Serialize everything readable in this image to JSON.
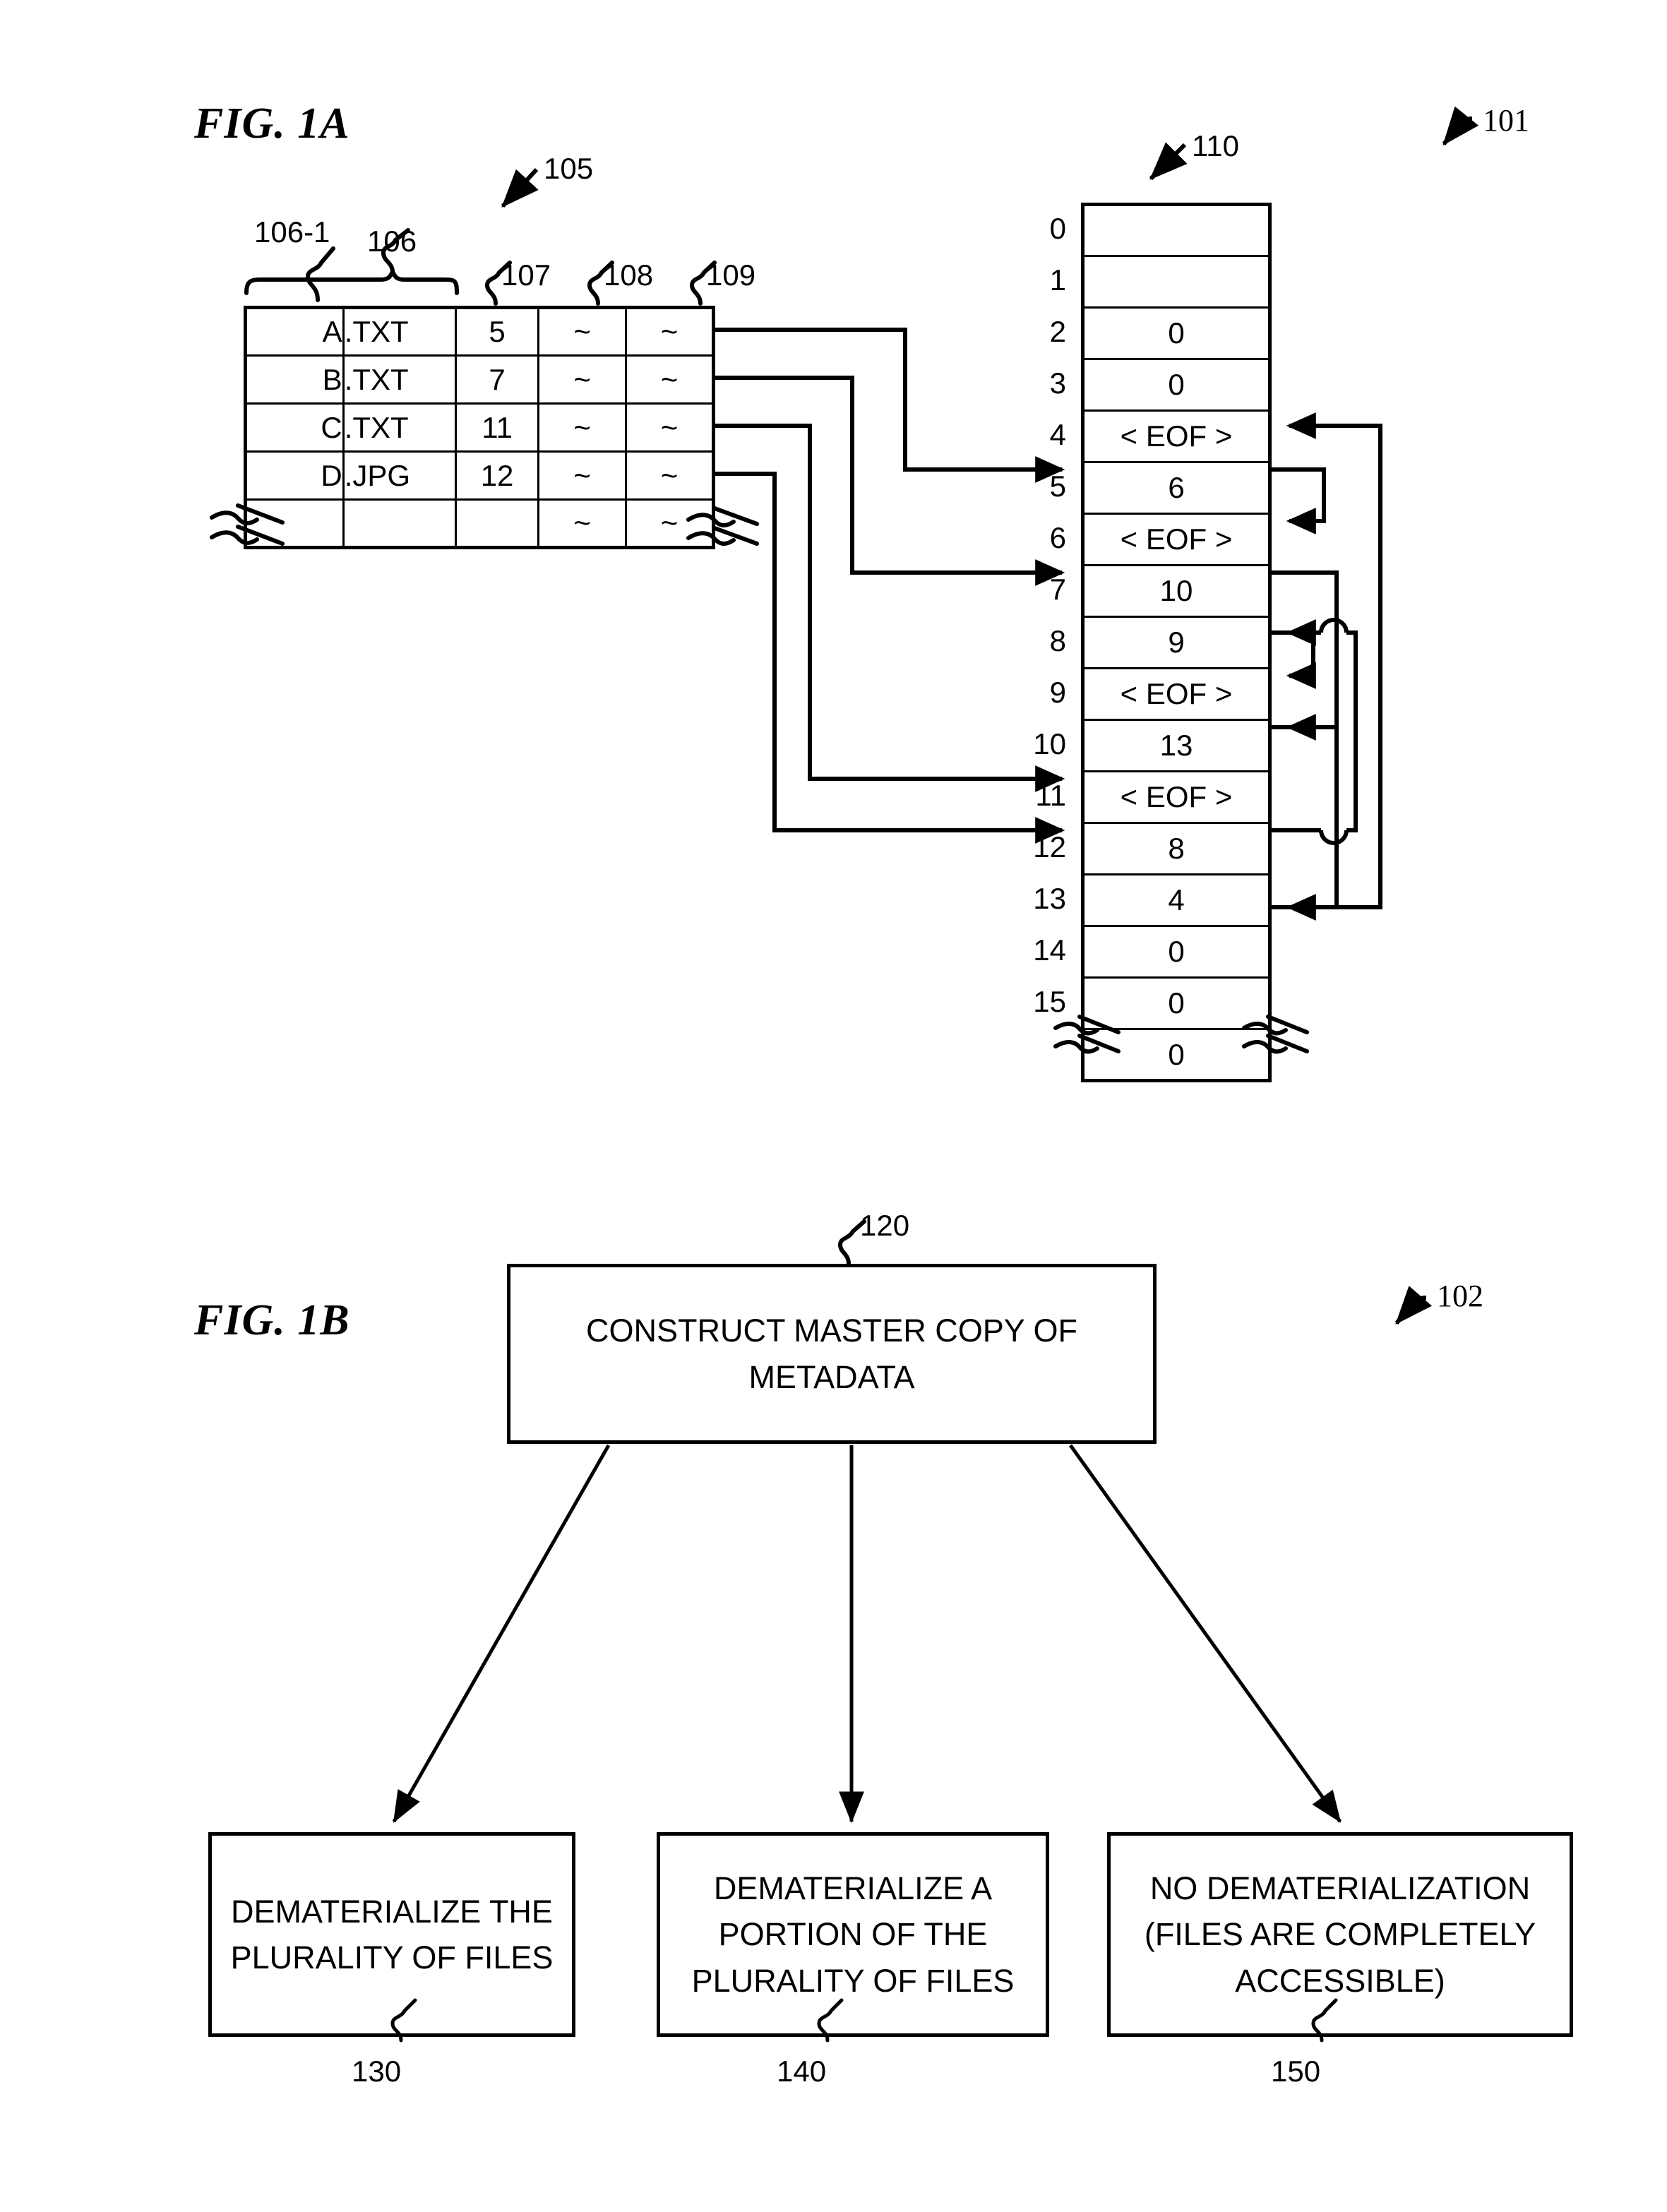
{
  "figures": {
    "fig_a_label": "FIG. 1A",
    "fig_b_label": "FIG. 1B",
    "fig_a_ref": "101",
    "fig_b_ref": "102"
  },
  "metadata_table": {
    "ref": "105",
    "brace_refs": {
      "filename_part": "106-1",
      "full_name": "106"
    },
    "column_refs": {
      "cluster": "107",
      "attr1": "108",
      "attr2": "109"
    },
    "rows": [
      {
        "name": "A",
        "ext": ".TXT",
        "cluster": "5",
        "attr1": "~",
        "attr2": "~"
      },
      {
        "name": "B",
        "ext": ".TXT",
        "cluster": "7",
        "attr1": "~",
        "attr2": "~"
      },
      {
        "name": "C",
        "ext": ".TXT",
        "cluster": "11",
        "attr1": "~",
        "attr2": "~"
      },
      {
        "name": "D",
        "ext": ".JPG",
        "cluster": "12",
        "attr1": "~",
        "attr2": "~"
      },
      {
        "name": "",
        "ext": "",
        "cluster": "",
        "attr1": "~",
        "attr2": "~"
      }
    ]
  },
  "fat_table": {
    "ref": "110",
    "entries": [
      {
        "index": "0",
        "value": ""
      },
      {
        "index": "1",
        "value": ""
      },
      {
        "index": "2",
        "value": "0"
      },
      {
        "index": "3",
        "value": "0"
      },
      {
        "index": "4",
        "value": "< EOF >"
      },
      {
        "index": "5",
        "value": "6"
      },
      {
        "index": "6",
        "value": "< EOF >"
      },
      {
        "index": "7",
        "value": "10"
      },
      {
        "index": "8",
        "value": "9"
      },
      {
        "index": "9",
        "value": "< EOF >"
      },
      {
        "index": "10",
        "value": "13"
      },
      {
        "index": "11",
        "value": "< EOF >"
      },
      {
        "index": "12",
        "value": "8"
      },
      {
        "index": "13",
        "value": "4"
      },
      {
        "index": "14",
        "value": "0"
      },
      {
        "index": "15",
        "value": "0"
      },
      {
        "index": "",
        "value": "0"
      }
    ]
  },
  "flow": {
    "start": {
      "ref": "120",
      "label": "CONSTRUCT MASTER COPY OF METADATA"
    },
    "branches": [
      {
        "ref": "130",
        "label": "DEMATERIALIZE THE PLURALITY OF FILES"
      },
      {
        "ref": "140",
        "label": "DEMATERIALIZE A PORTION OF THE PLURALITY OF FILES"
      },
      {
        "ref": "150",
        "label": "NO DEMATERIALIZATION (FILES ARE COMPLETELY ACCESSIBLE)"
      }
    ]
  },
  "colors": {
    "ink": "#000000",
    "paper": "#ffffff"
  }
}
